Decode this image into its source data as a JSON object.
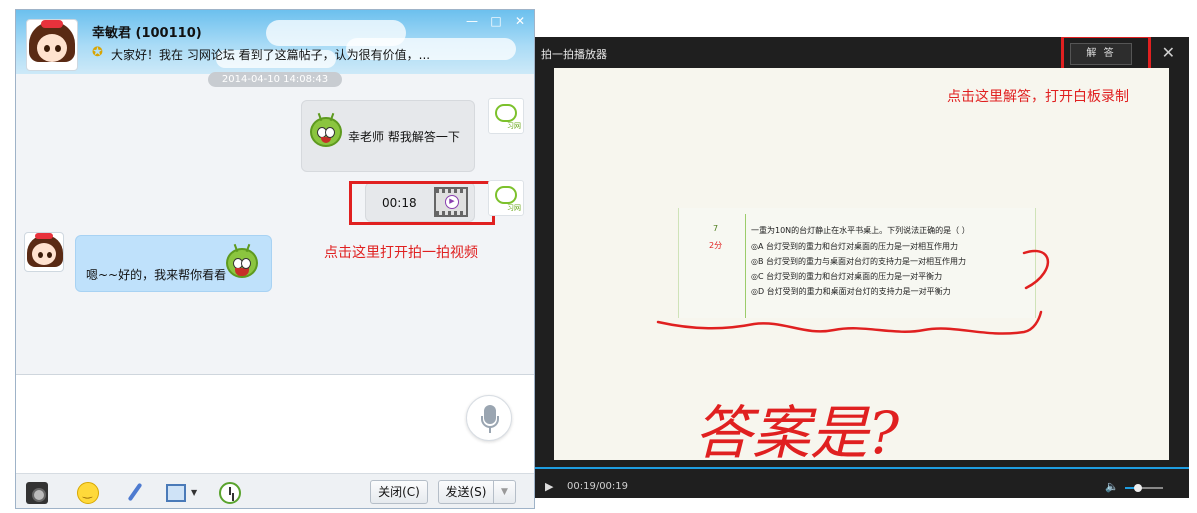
{
  "chat": {
    "contact_name": "幸敏君 (100110)",
    "signature": "大家好！我在 习网论坛 看到了这篇帖子，认为很有价值，...",
    "timestamp": "2014-04-10 14:08:43",
    "messages": [
      {
        "from": "me",
        "text": "幸老师 帮我解答一下"
      },
      {
        "from": "me",
        "video_duration": "00:18"
      },
      {
        "from": "contact",
        "text": "嗯~~好的，我来帮你看看"
      }
    ],
    "xiwang_badge": "习网",
    "annotation": "点击这里打开拍一拍视频",
    "buttons": {
      "close": "关闭(C)",
      "send": "发送(S)"
    },
    "window_controls": [
      "—",
      "□",
      "✕"
    ]
  },
  "player": {
    "title": "拍一拍播放器",
    "answer_button": "解 答",
    "annotation": "点击这里解答，打开白板录制",
    "close": "✕",
    "question": {
      "number": "7",
      "score": "2分",
      "lines": [
        "一重为10N的台灯静止在水平书桌上。下列说法正确的是（    ）",
        "◎A 台灯受到的重力和台灯对桌面的压力是一对相互作用力",
        "◎B 台灯受到的重力与桌面对台灯的支持力是一对相互作用力",
        "◎C 台灯受到的重力和台灯对桌面的压力是一对平衡力",
        "◎D 台灯受到的重力和桌面对台灯的支持力是一对平衡力"
      ]
    },
    "handwriting": "答案是?",
    "time_readout": "00:19/00:19",
    "volume_fraction": 0.35,
    "progress_fraction": 1.0
  },
  "colors": {
    "annotation_red": "#e02020",
    "accent_blue": "#1e9de0"
  }
}
